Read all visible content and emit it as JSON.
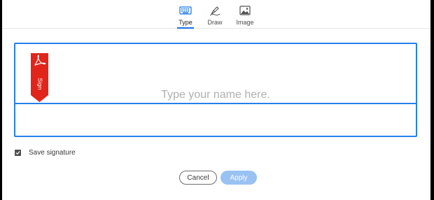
{
  "tabs": [
    {
      "label": "Type",
      "icon": "keyboard-icon",
      "active": true
    },
    {
      "label": "Draw",
      "icon": "pen-icon",
      "active": false
    },
    {
      "label": "Image",
      "icon": "image-icon",
      "active": false
    }
  ],
  "signature": {
    "placeholder": "Type your name here.",
    "value": "",
    "flag_text": "Sign"
  },
  "save_signature": {
    "label": "Save signature",
    "checked": true
  },
  "buttons": {
    "cancel": "Cancel",
    "apply": "Apply"
  },
  "colors": {
    "accent": "#2680eb",
    "flag": "#e1251b",
    "apply_disabled": "#99c2f3"
  }
}
